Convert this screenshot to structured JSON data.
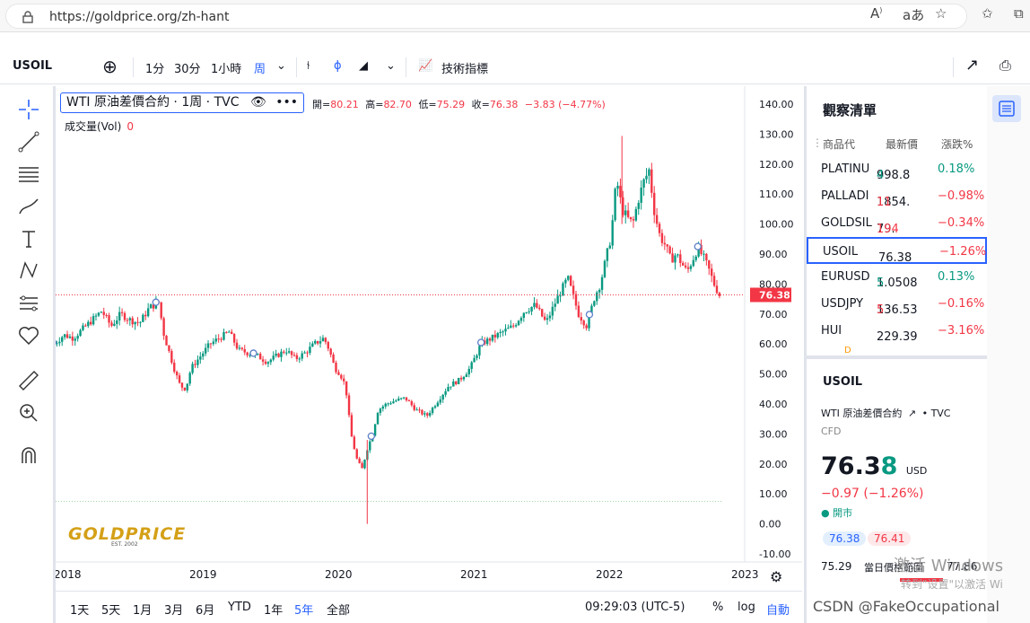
{
  "browser": {
    "url": "https://goldprice.org/zh-hant",
    "icons": [
      "lock-icon",
      "read-aloud-icon",
      "translate-icon",
      "add-favorite-icon",
      "favorites-icon",
      "collections-icon"
    ]
  },
  "toolbar": {
    "symbol": "USOIL",
    "intervals": [
      "1分",
      "30分",
      "1小時",
      "周"
    ],
    "active_interval": "周",
    "indicators_label": "技術指標"
  },
  "chart": {
    "legend_title": "WTI 原油差價合約 · 1周 · TVC",
    "ohlc": {
      "open_label": "開=",
      "open": "80.21",
      "high_label": "高=",
      "high": "82.70",
      "low_label": "低=",
      "low": "75.29",
      "close_label": "收=",
      "close": "76.38",
      "change": "−3.83 (−4.77%)"
    },
    "volume_label": "成交量(Vol)",
    "volume_value": "0",
    "current_price_tag": "76.38",
    "logo_text": "GOLDPRICE",
    "logo_sub": "EST. 2002",
    "colors": {
      "up": "#089981",
      "down": "#f23645",
      "accent": "#2962ff",
      "logo": "#d4a017"
    }
  },
  "chart_data": {
    "type": "candlestick",
    "title": "WTI 原油差價合約 · 1周 · TVC",
    "xlabel": "",
    "ylabel": "",
    "x_ticks": [
      "2018",
      "2019",
      "2020",
      "2021",
      "2022",
      "2023"
    ],
    "y_ticks": [
      "140.00",
      "130.00",
      "120.00",
      "110.00",
      "100.00",
      "90.00",
      "80.00",
      "70.00",
      "60.00",
      "50.00",
      "40.00",
      "30.00",
      "20.00",
      "10.00",
      "0.00",
      "-10.00"
    ],
    "ylim": [
      -10,
      140
    ],
    "xlim": [
      2018.0,
      2023.0
    ],
    "series": [
      {
        "x": [
          2017.99,
          2018.06,
          2018.13,
          2018.2,
          2018.27,
          2018.34,
          2018.41,
          2018.48,
          2018.55,
          2018.62,
          2018.69,
          2018.76,
          2018.8,
          2018.84,
          2018.88,
          2018.92,
          2018.96,
          2019.0,
          2019.07,
          2019.14,
          2019.21,
          2019.28,
          2019.35,
          2019.42,
          2019.49,
          2019.56,
          2019.63,
          2019.7,
          2019.77,
          2019.84,
          2019.91,
          2019.98,
          2020.02,
          2020.06,
          2020.1,
          2020.14,
          2020.18,
          2020.22,
          2020.26,
          2020.3,
          2020.34,
          2020.38,
          2020.44,
          2020.5,
          2020.58,
          2020.66,
          2020.74,
          2020.82,
          2020.9,
          2020.98,
          2021.06,
          2021.14,
          2021.22,
          2021.3,
          2021.38,
          2021.46,
          2021.54,
          2021.62,
          2021.7,
          2021.78,
          2021.86,
          2021.92,
          2021.98,
          2022.02,
          2022.06,
          2022.1,
          2022.14,
          2022.18,
          2022.22,
          2022.26,
          2022.3,
          2022.34,
          2022.38,
          2022.42,
          2022.46,
          2022.5,
          2022.54,
          2022.58,
          2022.62,
          2022.66,
          2022.7,
          2022.74,
          2022.78,
          2022.82,
          2022.86,
          2022.9
        ],
        "close": [
          60,
          63,
          62,
          65,
          68,
          71,
          66,
          70,
          68,
          67,
          72,
          74,
          63,
          57,
          51,
          46,
          45,
          52,
          56,
          60,
          62,
          64,
          58,
          57,
          56,
          54,
          56,
          58,
          55,
          57,
          60,
          62,
          58,
          52,
          50,
          46,
          30,
          22,
          18,
          25,
          30,
          38,
          40,
          41,
          42,
          38,
          36,
          41,
          46,
          48,
          52,
          60,
          62,
          64,
          66,
          71,
          73,
          67,
          75,
          82,
          70,
          66,
          76,
          80,
          88,
          96,
          115,
          105,
          102,
          100,
          108,
          114,
          118,
          104,
          96,
          93,
          88,
          90,
          87,
          84,
          88,
          92,
          89,
          85,
          80,
          76.38
        ]
      }
    ],
    "markers": [
      2017.98,
      2018.74,
      2019.46,
      2020.33,
      2021.14,
      2021.94,
      2022.74
    ]
  },
  "bottom_bar": {
    "ranges": [
      "1天",
      "5天",
      "1月",
      "3月",
      "6月",
      "YTD",
      "1年",
      "5年",
      "全部"
    ],
    "active_range": "5年",
    "time": "09:29:03 (UTC-5)",
    "percent": "%",
    "log": "log",
    "auto": "自動"
  },
  "watchlist": {
    "title": "觀察清單",
    "headers": [
      "商品代",
      "最新價",
      "漲跌%"
    ],
    "rows": [
      {
        "symbol": "PLATINU",
        "price": "998.8",
        "price_last": "4",
        "change": "0.18%",
        "dir": "up"
      },
      {
        "symbol": "PALLADI",
        "price": "1854.",
        "price_last": "11",
        "change": "−0.98%",
        "dir": "down"
      },
      {
        "symbol": "GOLDSIL",
        "price": "79.",
        "price_last": "194",
        "change": "−0.34%",
        "dir": "down"
      },
      {
        "symbol": "USOIL",
        "price": "76.38",
        "price_last": "",
        "change": "−1.26%",
        "dir": "down"
      },
      {
        "symbol": "EURUSD",
        "price": "1.0508",
        "price_last": "5",
        "change": "0.13%",
        "dir": "up"
      },
      {
        "symbol": "USDJPY",
        "price": "136.53",
        "price_last": "5",
        "change": "−0.16%",
        "dir": "down"
      },
      {
        "symbol": "HUI",
        "price": "229.39",
        "price_last": "",
        "change": "−3.16%",
        "dir": "down"
      }
    ]
  },
  "detail": {
    "symbol": "USOIL",
    "name": "WTI 原油差價合約",
    "exchange": "TVC",
    "type": "CFD",
    "price_main": "76.3",
    "price_last": "8",
    "unit": "USD",
    "change": "−0.97 (−1.26%)",
    "status": "開市",
    "bid": "76.38",
    "ask": "76.41",
    "range_low": "75.29",
    "range_label": "當日價格範圍",
    "range_high": "77.86"
  },
  "overlay": {
    "windows": "激活 Windows",
    "windows_sub": "转到\"设置\"以激活 Wi",
    "csdn": "CSDN @FakeOccupational"
  }
}
